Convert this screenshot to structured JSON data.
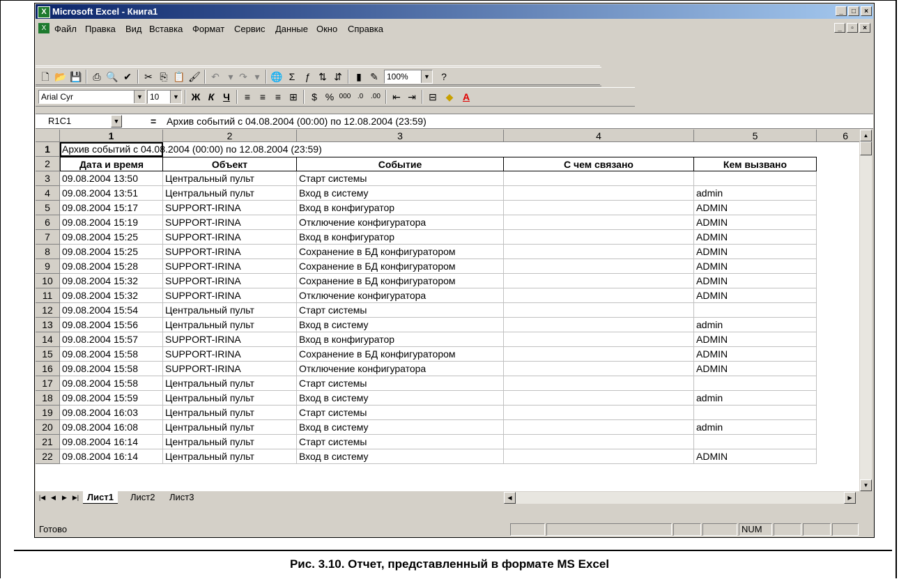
{
  "window": {
    "title": "Microsoft Excel - Книга1",
    "app_icon": "excel-icon",
    "controls": [
      "_",
      "□",
      "×"
    ],
    "doc_controls": [
      "_",
      "▫",
      "×"
    ]
  },
  "menu": [
    "Файл",
    "Правка",
    "Вид",
    "Вставка",
    "Формат",
    "Сервис",
    "Данные",
    "Окно",
    "Справка"
  ],
  "toolbar_standard": {
    "zoom": "100%",
    "icons": [
      "new-icon",
      "open-icon",
      "save-icon",
      "print-icon",
      "print-preview-icon",
      "spelling-icon",
      "cut-icon",
      "copy-icon",
      "paste-icon",
      "format-painter-icon",
      "undo-icon",
      "redo-icon",
      "insert-hyperlink-icon",
      "autosum-icon",
      "function-icon",
      "sort-ascending-icon",
      "sort-descending-icon",
      "chart-wizard-icon",
      "drawing-icon",
      "help-icon"
    ]
  },
  "toolbar_formatting": {
    "font": "Arial Cyr",
    "size": "10",
    "bold": "Ж",
    "italic": "К",
    "underline": "Ч"
  },
  "formula_bar": {
    "name_box": "R1C1",
    "equals": "=",
    "content": "Архив событий с 04.08.2004 (00:00) по 12.08.2004 (23:59)"
  },
  "sheet": {
    "column_headers": [
      "1",
      "2",
      "3",
      "4",
      "5",
      "6"
    ],
    "title_cell": "Архив событий с 04.08.2004 (00:00) по 12.08.2004 (23:59)",
    "header_row": [
      "Дата и время",
      "Объект",
      "Событие",
      "С чем связано",
      "Кем вызвано"
    ],
    "rows": [
      {
        "n": "3",
        "cells": [
          "09.08.2004 13:50",
          "Центральный пульт",
          "Старт системы",
          "",
          ""
        ]
      },
      {
        "n": "4",
        "cells": [
          "09.08.2004 13:51",
          "Центральный пульт",
          "Вход в систему",
          "",
          "admin"
        ]
      },
      {
        "n": "5",
        "cells": [
          "09.08.2004 15:17",
          "SUPPORT-IRINA",
          "Вход в конфигуратор",
          "",
          "ADMIN"
        ]
      },
      {
        "n": "6",
        "cells": [
          "09.08.2004 15:19",
          "SUPPORT-IRINA",
          "Отключение конфигуратора",
          "",
          "ADMIN"
        ]
      },
      {
        "n": "7",
        "cells": [
          "09.08.2004 15:25",
          "SUPPORT-IRINA",
          "Вход в конфигуратор",
          "",
          "ADMIN"
        ]
      },
      {
        "n": "8",
        "cells": [
          "09.08.2004 15:25",
          "SUPPORT-IRINA",
          "Сохранение в БД конфигуратором",
          "",
          "ADMIN"
        ]
      },
      {
        "n": "9",
        "cells": [
          "09.08.2004 15:28",
          "SUPPORT-IRINA",
          "Сохранение в БД конфигуратором",
          "",
          "ADMIN"
        ]
      },
      {
        "n": "10",
        "cells": [
          "09.08.2004 15:32",
          "SUPPORT-IRINA",
          "Сохранение в БД конфигуратором",
          "",
          "ADMIN"
        ]
      },
      {
        "n": "11",
        "cells": [
          "09.08.2004 15:32",
          "SUPPORT-IRINA",
          "Отключение конфигуратора",
          "",
          "ADMIN"
        ]
      },
      {
        "n": "12",
        "cells": [
          "09.08.2004 15:54",
          "Центральный пульт",
          "Старт системы",
          "",
          ""
        ]
      },
      {
        "n": "13",
        "cells": [
          "09.08.2004 15:56",
          "Центральный пульт",
          "Вход в систему",
          "",
          "admin"
        ]
      },
      {
        "n": "14",
        "cells": [
          "09.08.2004 15:57",
          "SUPPORT-IRINA",
          "Вход в конфигуратор",
          "",
          "ADMIN"
        ]
      },
      {
        "n": "15",
        "cells": [
          "09.08.2004 15:58",
          "SUPPORT-IRINA",
          "Сохранение в БД конфигуратором",
          "",
          "ADMIN"
        ]
      },
      {
        "n": "16",
        "cells": [
          "09.08.2004 15:58",
          "SUPPORT-IRINA",
          "Отключение конфигуратора",
          "",
          "ADMIN"
        ]
      },
      {
        "n": "17",
        "cells": [
          "09.08.2004 15:58",
          "Центральный пульт",
          "Старт системы",
          "",
          ""
        ]
      },
      {
        "n": "18",
        "cells": [
          "09.08.2004 15:59",
          "Центральный пульт",
          "Вход в систему",
          "",
          "admin"
        ]
      },
      {
        "n": "19",
        "cells": [
          "09.08.2004 16:03",
          "Центральный пульт",
          "Старт системы",
          "",
          ""
        ]
      },
      {
        "n": "20",
        "cells": [
          "09.08.2004 16:08",
          "Центральный пульт",
          "Вход в систему",
          "",
          "admin"
        ]
      },
      {
        "n": "21",
        "cells": [
          "09.08.2004 16:14",
          "Центральный пульт",
          "Старт системы",
          "",
          ""
        ]
      },
      {
        "n": "22",
        "cells": [
          "09.08.2004 16:14",
          "Центральный пульт",
          "Вход в систему",
          "",
          "ADMIN"
        ]
      }
    ]
  },
  "sheet_tabs": [
    "Лист1",
    "Лист2",
    "Лист3"
  ],
  "status": {
    "text": "Готово",
    "num": "NUM"
  },
  "caption": "Рис. 3.10. Отчет, представленный в формате MS Excel"
}
